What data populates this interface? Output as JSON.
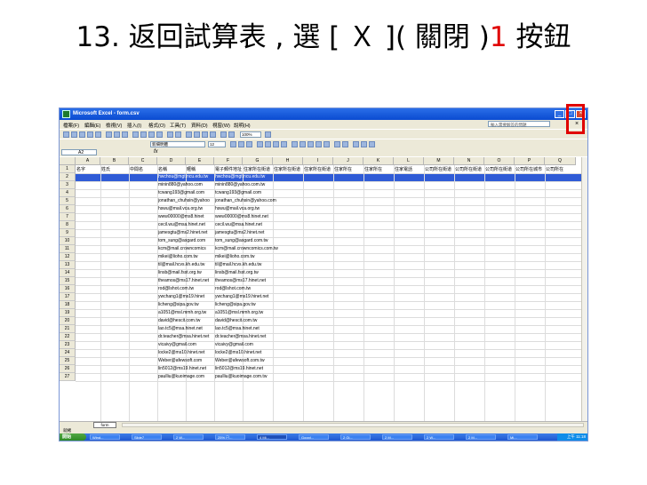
{
  "slide": {
    "title_prefix": "13. 返回試算表 , 選 [ Ｘ ]( 關閉 )",
    "title_num": "1",
    "title_suffix": " 按鈕"
  },
  "window": {
    "title": "Microsoft Excel - form.csv",
    "minimize": "_",
    "restore": "□",
    "close": "×"
  },
  "menu": {
    "items": [
      "檔案(F)",
      "編輯(E)",
      "檢視(V)",
      "插入(I)",
      "格式(O)",
      "工具(T)",
      "資料(D)",
      "視窗(W)",
      "說明(H)"
    ],
    "help_placeholder": "輸入需要解答的問題",
    "doc_close": "×"
  },
  "toolbar": {
    "zoom": "100%",
    "font": "新細明體",
    "size": "12"
  },
  "formula": {
    "namebox": "A2",
    "fx": "fx"
  },
  "grid": {
    "columns": [
      "A",
      "B",
      "C",
      "D",
      "E",
      "F",
      "G",
      "H",
      "I",
      "J",
      "K",
      "L",
      "M",
      "N",
      "O",
      "P",
      "Q"
    ],
    "header_row": [
      "名字",
      "姓氏",
      "中間名",
      "名稱",
      "暱稱",
      "電子郵件地址",
      "住家所在街道",
      "住家所在街道",
      "住家所在街道",
      "住家所在",
      "住家所在",
      "住家電話",
      "公司所在街道",
      "公司所在街道",
      "公司所在街道",
      "公司所在城市",
      "公司所在"
    ],
    "row2_d": "hwchou@mgt.ncu.edu.tw",
    "row2_f": "hwchou@mgt.ncu.edu.tw",
    "rows": [
      {
        "n": "1"
      },
      {
        "n": "2"
      },
      {
        "n": "3",
        "d": "minin880@yahoo.com",
        "f": "minin880@yahoo.com.tw"
      },
      {
        "n": "4",
        "d": "tcwang193@gmail.com",
        "f": "tcwang193@gmail.com"
      },
      {
        "n": "5",
        "d": "jonathan_chuhsin@yahoo",
        "f": "jonathan_chuhsin@yahoo.com"
      },
      {
        "n": "6",
        "d": "hswu@mail.vca.org.tw",
        "f": "hswu@mail.vca.org.tw"
      },
      {
        "n": "7",
        "d": "www00000@ms8.hinet",
        "f": "www00000@ms8.hinet.net"
      },
      {
        "n": "8",
        "d": "cecil.wu@msa.hinet.net",
        "f": "cecil.wu@msa.hinet.net"
      },
      {
        "n": "9",
        "d": "jamesgtu@ms2.hinet.net",
        "f": "jamesgtu@ms2.hinet.net"
      },
      {
        "n": "10",
        "d": "tom_sung@asgard.com",
        "f": "tom_sung@asgard.com.tw"
      },
      {
        "n": "11",
        "d": "kcm@mail.crowncomics",
        "f": "kcm@mail.crowncomics.com.tw"
      },
      {
        "n": "12",
        "d": "mikei@lioho.com.tw",
        "f": "mikei@lioho.com.tw"
      },
      {
        "n": "13",
        "d": "til@mail.hcvs.kh.edu.tw",
        "f": "til@mail.hcvs.kh.edu.tw"
      },
      {
        "n": "14",
        "d": "linsb@mail.fsst.org.tw",
        "f": "linsb@mail.fsst.org.tw"
      },
      {
        "n": "15",
        "d": "theamos@ms17.hinet.net",
        "f": "theamos@ms17.hinet.net"
      },
      {
        "n": "16",
        "d": "rod@lshot.com.tw",
        "f": "rod@lshot.com.tw"
      },
      {
        "n": "17",
        "d": "ywchang1@ms19.hinet",
        "f": "ywchang1@ms19.hinet.net"
      },
      {
        "n": "18",
        "d": "licheng@sipa.gov.tw",
        "f": "licheng@sipa.gov.tw"
      },
      {
        "n": "19",
        "d": "a1051@msl.mmh.org.tw",
        "f": "a1051@msl.mmh.org.tw"
      },
      {
        "n": "20",
        "d": "david@hescit.com.tw",
        "f": "david@hescit.com.tw"
      },
      {
        "n": "21",
        "d": "lao.tc5@msa.hinet.net",
        "f": "lao.tc5@msa.hinet.net"
      },
      {
        "n": "22",
        "d": "dr.teacher@msa.hinet.net",
        "f": "dr.teacher@msa.hinet.net"
      },
      {
        "n": "23",
        "d": "vicaivy@gmail.com",
        "f": "vicaivy@gmail.com"
      },
      {
        "n": "24",
        "d": "locke2@ms10.hinet.net",
        "f": "locke2@ms10.hinet.net"
      },
      {
        "n": "25",
        "d": "Weber@afewsoft.com",
        "f": "Weber@afewsoft.com.tw"
      },
      {
        "n": "26",
        "d": "lin5012@ms19.hinet.net",
        "f": "lin5012@ms19.hinet.net"
      },
      {
        "n": "27",
        "d": "paulliu@kuoimage.com",
        "f": "paulliu@kuoimage.com.tw"
      }
    ]
  },
  "sheet": {
    "tab": "form",
    "status": "就緒"
  },
  "taskbar": {
    "start": "開始",
    "items": [
      "Wind...",
      "Slide7",
      "2 W...",
      "25% 已...",
      "4 Mi...",
      "Googl...",
      "2 Gi...",
      "2 M...",
      "2 W...",
      "2 M...",
      "Mi..."
    ],
    "clock": "上午 11:18"
  }
}
